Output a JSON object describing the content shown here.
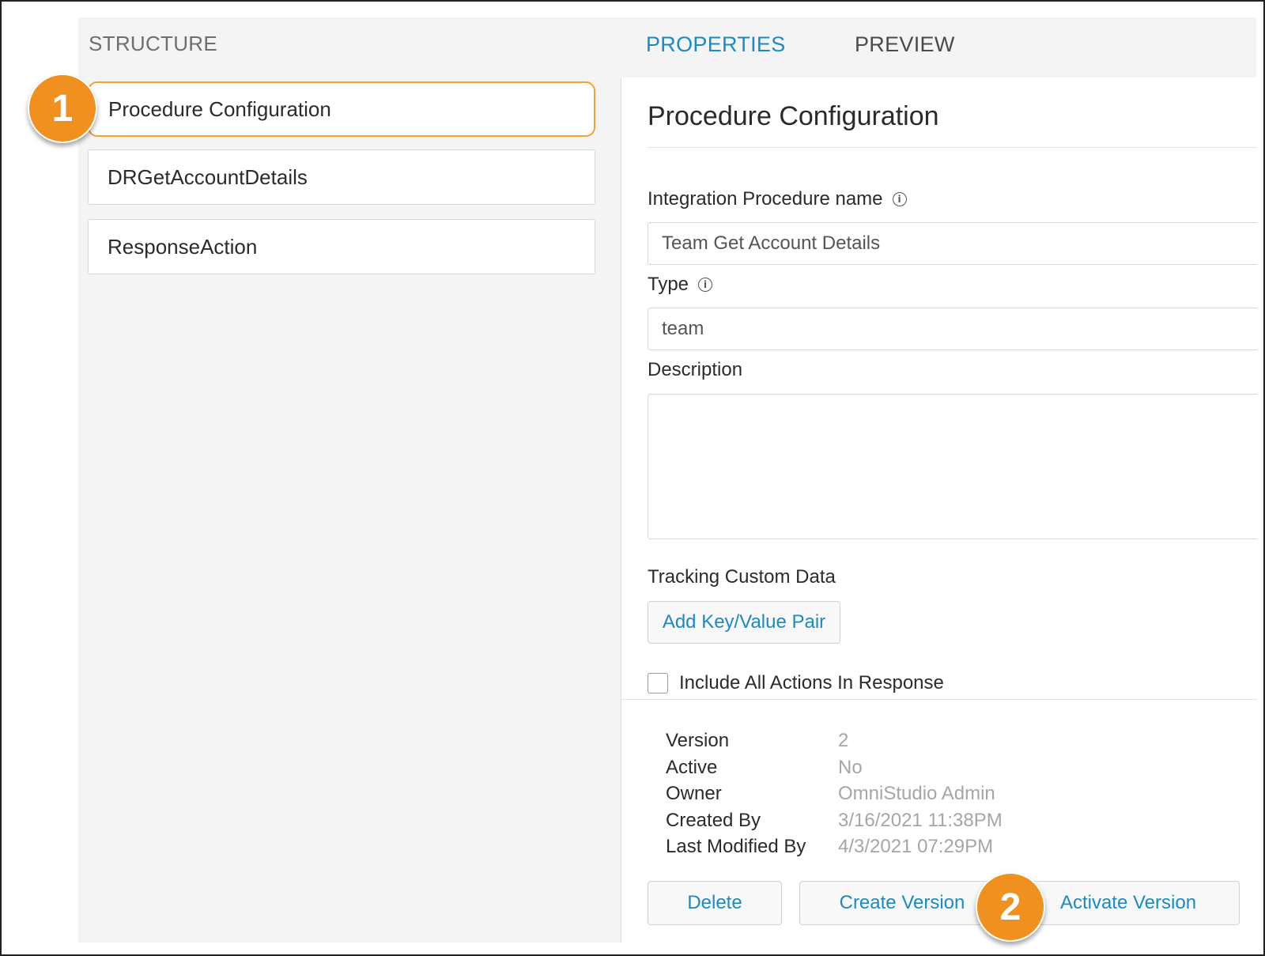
{
  "header": {
    "structure_label": "STRUCTURE",
    "properties_tab": "PROPERTIES",
    "preview_tab": "PREVIEW"
  },
  "tree": {
    "items": [
      {
        "label": "Procedure Configuration",
        "selected": true
      },
      {
        "label": "DRGetAccountDetails",
        "selected": false
      },
      {
        "label": "ResponseAction",
        "selected": false
      }
    ]
  },
  "properties": {
    "title": "Procedure Configuration",
    "name_label": "Integration Procedure name",
    "name_value": "Team Get Account Details",
    "type_label": "Type",
    "type_value": "team",
    "description_label": "Description",
    "description_value": "",
    "tracking_label": "Tracking Custom Data",
    "add_pair_button": "Add Key/Value Pair",
    "include_actions_label": "Include All Actions In Response",
    "include_actions_checked": false
  },
  "metadata": {
    "rows": [
      {
        "key": "Version",
        "value": "2"
      },
      {
        "key": "Active",
        "value": "No"
      },
      {
        "key": "Owner",
        "value": "OmniStudio Admin"
      },
      {
        "key": "Created By",
        "value": "3/16/2021 11:38PM"
      },
      {
        "key": "Last Modified By",
        "value": "4/3/2021 07:29PM"
      }
    ]
  },
  "footer": {
    "delete_button": "Delete",
    "create_version_button": "Create Version",
    "activate_version_button": "Activate Version"
  },
  "callouts": [
    "1",
    "2"
  ],
  "colors": {
    "accent": "#1b8ac4",
    "callout": "#f0901f",
    "selected_border": "#f5a131"
  }
}
